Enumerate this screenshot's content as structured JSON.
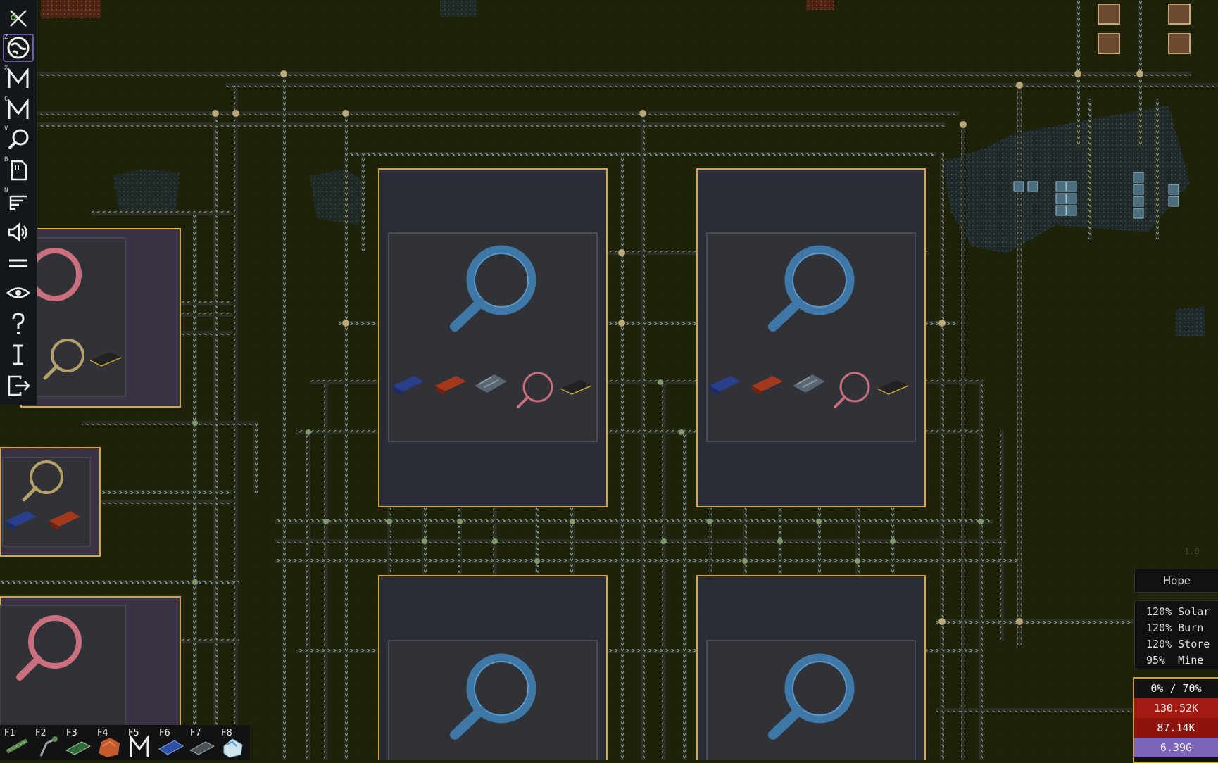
{
  "toolbar": {
    "items": [
      {
        "name": "drone",
        "key": ""
      },
      {
        "name": "planet",
        "key": "Z"
      },
      {
        "name": "map-x",
        "key": "X"
      },
      {
        "name": "map-c",
        "key": "C"
      },
      {
        "name": "magnifier",
        "key": "V"
      },
      {
        "name": "blueprint",
        "key": "B"
      },
      {
        "name": "list",
        "key": "N"
      },
      {
        "name": "sound",
        "key": ""
      },
      {
        "name": "menu",
        "key": ""
      },
      {
        "name": "eye",
        "key": ""
      },
      {
        "name": "help",
        "key": ""
      },
      {
        "name": "info",
        "key": ""
      },
      {
        "name": "exit",
        "key": ""
      }
    ]
  },
  "hotbar": {
    "slots": [
      {
        "key": "F1",
        "item": "belt"
      },
      {
        "key": "F2",
        "item": "inserter"
      },
      {
        "key": "F3",
        "item": "circuit-board"
      },
      {
        "key": "F4",
        "item": "copper-ore"
      },
      {
        "key": "F5",
        "item": "machine"
      },
      {
        "key": "F6",
        "item": "solar-panel"
      },
      {
        "key": "F7",
        "item": "rail"
      },
      {
        "key": "F8",
        "item": "crystal"
      }
    ]
  },
  "status": {
    "name": "Hope",
    "multipliers": [
      {
        "percent": "120%",
        "label": "Solar"
      },
      {
        "percent": "120%",
        "label": "Burn"
      },
      {
        "percent": "120%",
        "label": "Store"
      },
      {
        "percent": "95%",
        "label": "Mine"
      }
    ],
    "progress": "0% / 70%",
    "resources": [
      {
        "value": "130.52K",
        "color": "#a31b12"
      },
      {
        "value": "87.14K",
        "color": "#8e130d"
      },
      {
        "value": "6.39G",
        "color": "#7c64b8"
      }
    ]
  },
  "version": "1.0",
  "colors": {
    "ground": "#1d2208",
    "building_border": "#d8a93a",
    "building_fill": "#2c2d33",
    "magnifier_blue": "#3f7aa8",
    "magnifier_pink": "#c96f7d",
    "belt": "#8a9177"
  }
}
